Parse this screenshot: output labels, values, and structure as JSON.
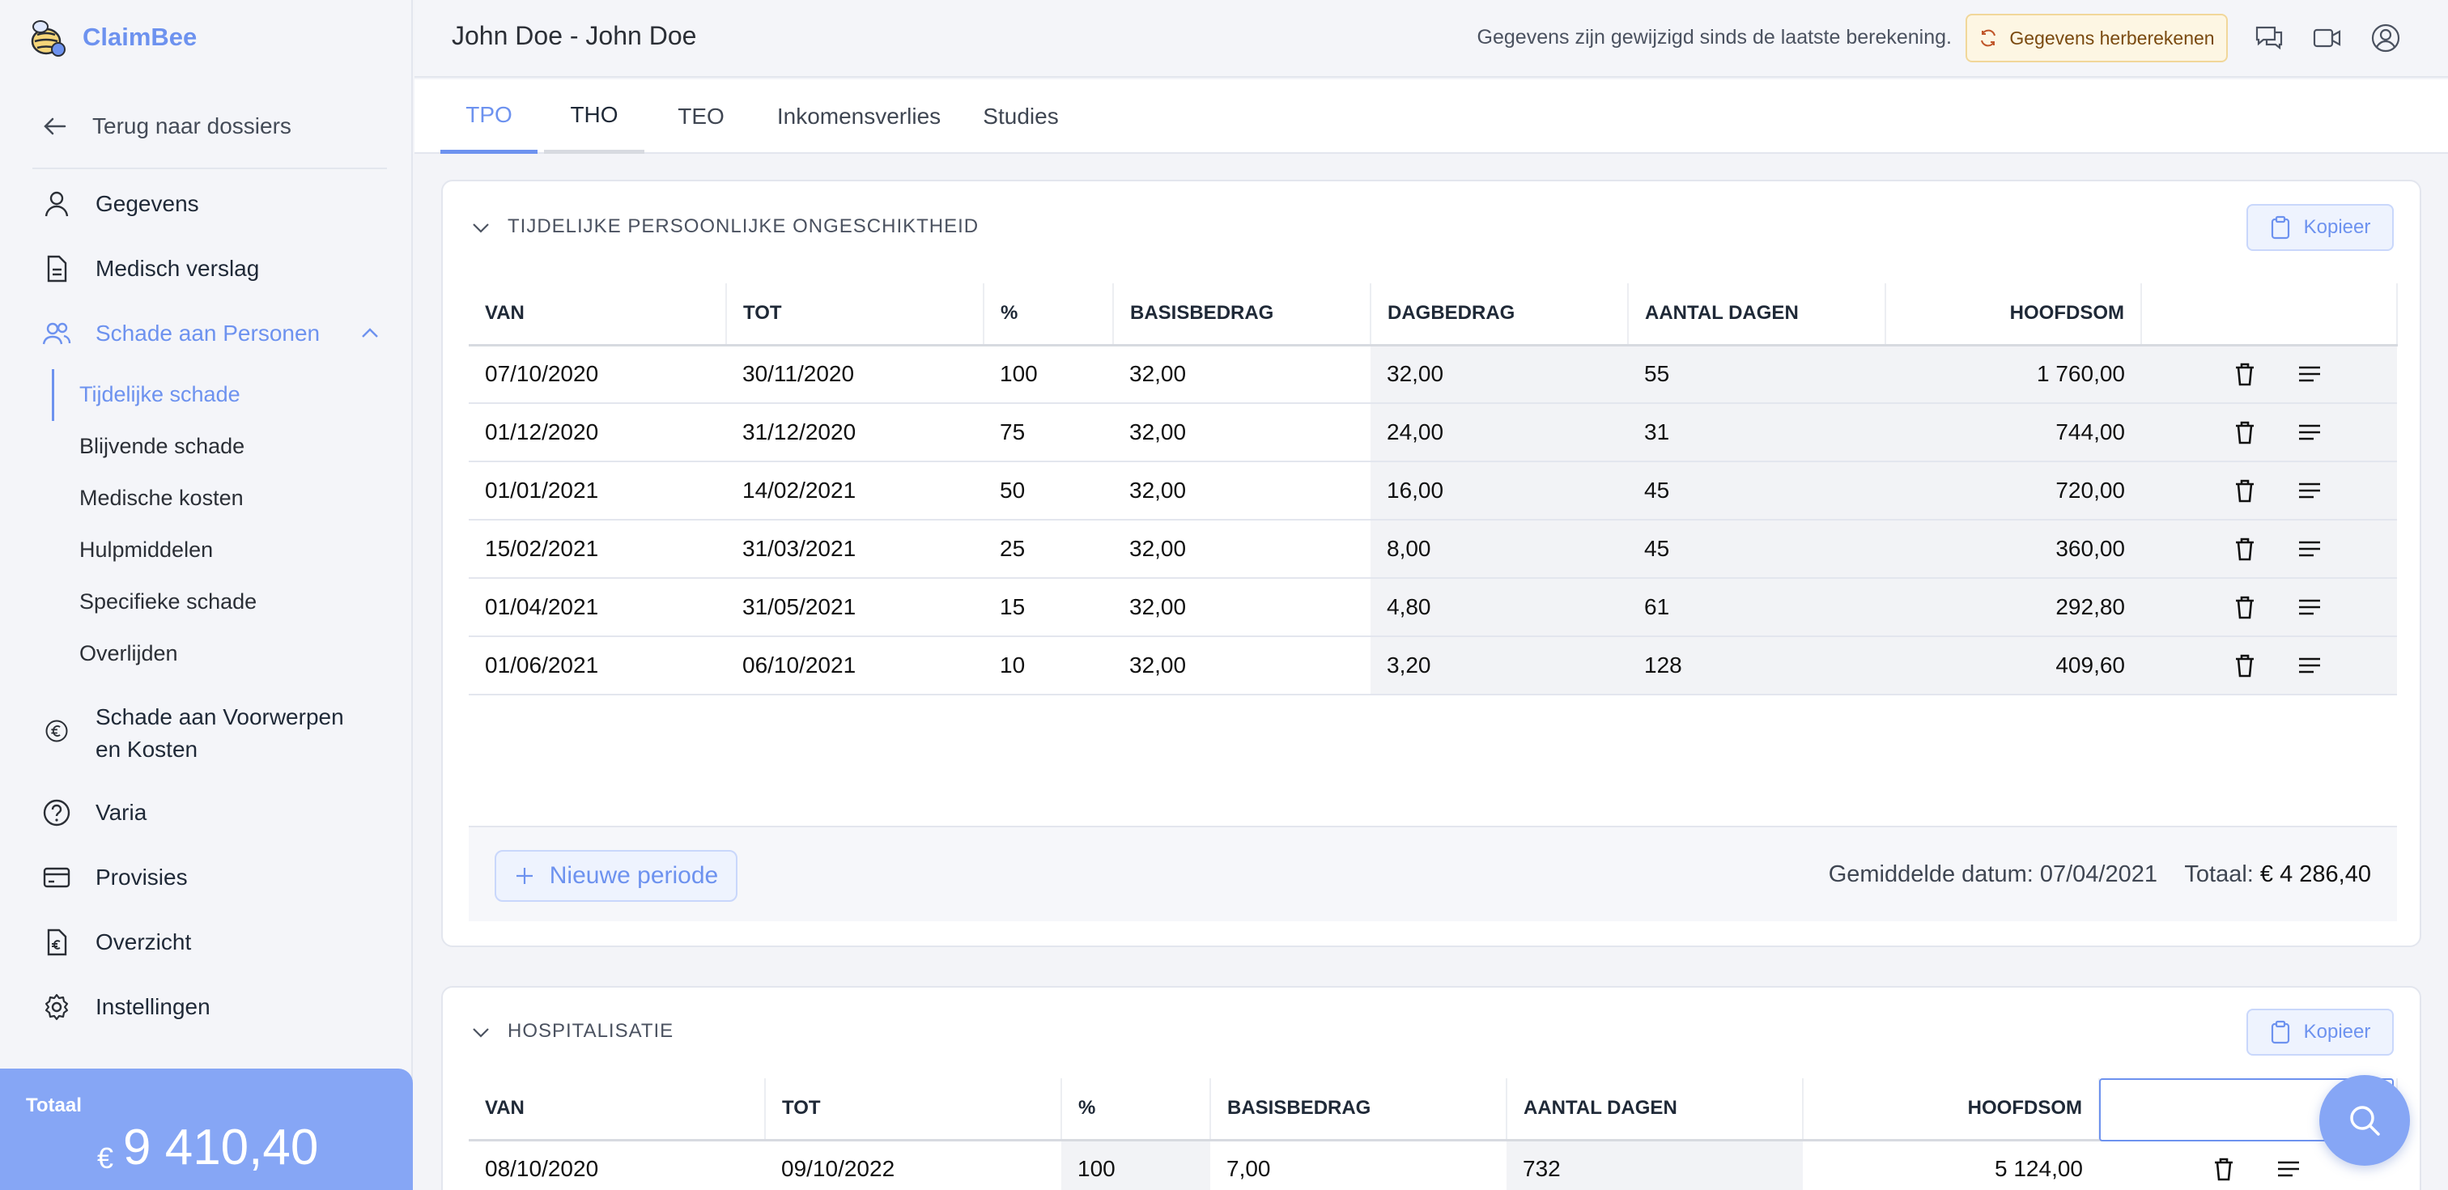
{
  "app": {
    "name": "ClaimBee"
  },
  "header": {
    "title": "John Doe - John Doe",
    "notice": "Gegevens zijn gewijzigd sinds de laatste berekening.",
    "recalc_label": "Gegevens herberekenen"
  },
  "sidebar": {
    "back_label": "Terug naar dossiers",
    "items": [
      {
        "label": "Gegevens",
        "icon": "user-icon"
      },
      {
        "label": "Medisch verslag",
        "icon": "document-icon"
      },
      {
        "label": "Schade aan Personen",
        "icon": "users-icon"
      },
      {
        "label": "Schade aan Voorwerpen en Kosten",
        "icon": "euro-icon"
      },
      {
        "label": "Varia",
        "icon": "question-icon"
      },
      {
        "label": "Provisies",
        "icon": "card-icon"
      },
      {
        "label": "Overzicht",
        "icon": "euro-document-icon"
      },
      {
        "label": "Instellingen",
        "icon": "gear-icon"
      }
    ],
    "voorwerpen_line1": "Schade aan Voorwerpen",
    "voorwerpen_line2": "en Kosten",
    "subitems": [
      {
        "label": "Tijdelijke schade"
      },
      {
        "label": "Blijvende schade"
      },
      {
        "label": "Medische kosten"
      },
      {
        "label": "Hulpmiddelen"
      },
      {
        "label": "Specifieke schade"
      },
      {
        "label": "Overlijden"
      }
    ],
    "total_label": "Totaal",
    "total_currency": "€",
    "total_value": "9 410,40"
  },
  "tabs": [
    {
      "label": "TPO"
    },
    {
      "label": "THO"
    },
    {
      "label": "TEO"
    },
    {
      "label": "Inkomensverlies"
    },
    {
      "label": "Studies"
    }
  ],
  "tpo": {
    "title": "TIJDELIJKE PERSOONLIJKE ONGESCHIKTHEID",
    "copy_label": "Kopieer",
    "columns": [
      "VAN",
      "TOT",
      "%",
      "BASISBEDRAG",
      "DAGBEDRAG",
      "AANTAL DAGEN",
      "HOOFDSOM"
    ],
    "rows": [
      [
        "07/10/2020",
        "30/11/2020",
        "100",
        "32,00",
        "32,00",
        "55",
        "1 760,00"
      ],
      [
        "01/12/2020",
        "31/12/2020",
        "75",
        "32,00",
        "24,00",
        "31",
        "744,00"
      ],
      [
        "01/01/2021",
        "14/02/2021",
        "50",
        "32,00",
        "16,00",
        "45",
        "720,00"
      ],
      [
        "15/02/2021",
        "31/03/2021",
        "25",
        "32,00",
        "8,00",
        "45",
        "360,00"
      ],
      [
        "01/04/2021",
        "31/05/2021",
        "15",
        "32,00",
        "4,80",
        "61",
        "292,80"
      ],
      [
        "01/06/2021",
        "06/10/2021",
        "10",
        "32,00",
        "3,20",
        "128",
        "409,60"
      ]
    ],
    "new_period_label": "Nieuwe periode",
    "avg_date_label": "Gemiddelde datum: 07/04/2021",
    "total_label": "Totaal:",
    "total_value": "€ 4 286,40"
  },
  "hosp": {
    "title": "HOSPITALISATIE",
    "copy_label": "Kopieer",
    "columns": [
      "VAN",
      "TOT",
      "%",
      "BASISBEDRAG",
      "AANTAL DAGEN",
      "HOOFDSOM"
    ],
    "rows": [
      [
        "08/10/2020",
        "09/10/2022",
        "100",
        "7,00",
        "732",
        "5 124,00"
      ]
    ]
  },
  "colors": {
    "accent": "#6d92ef",
    "total_bg": "#86a6f5",
    "warn_bg": "#fdf6e3"
  }
}
